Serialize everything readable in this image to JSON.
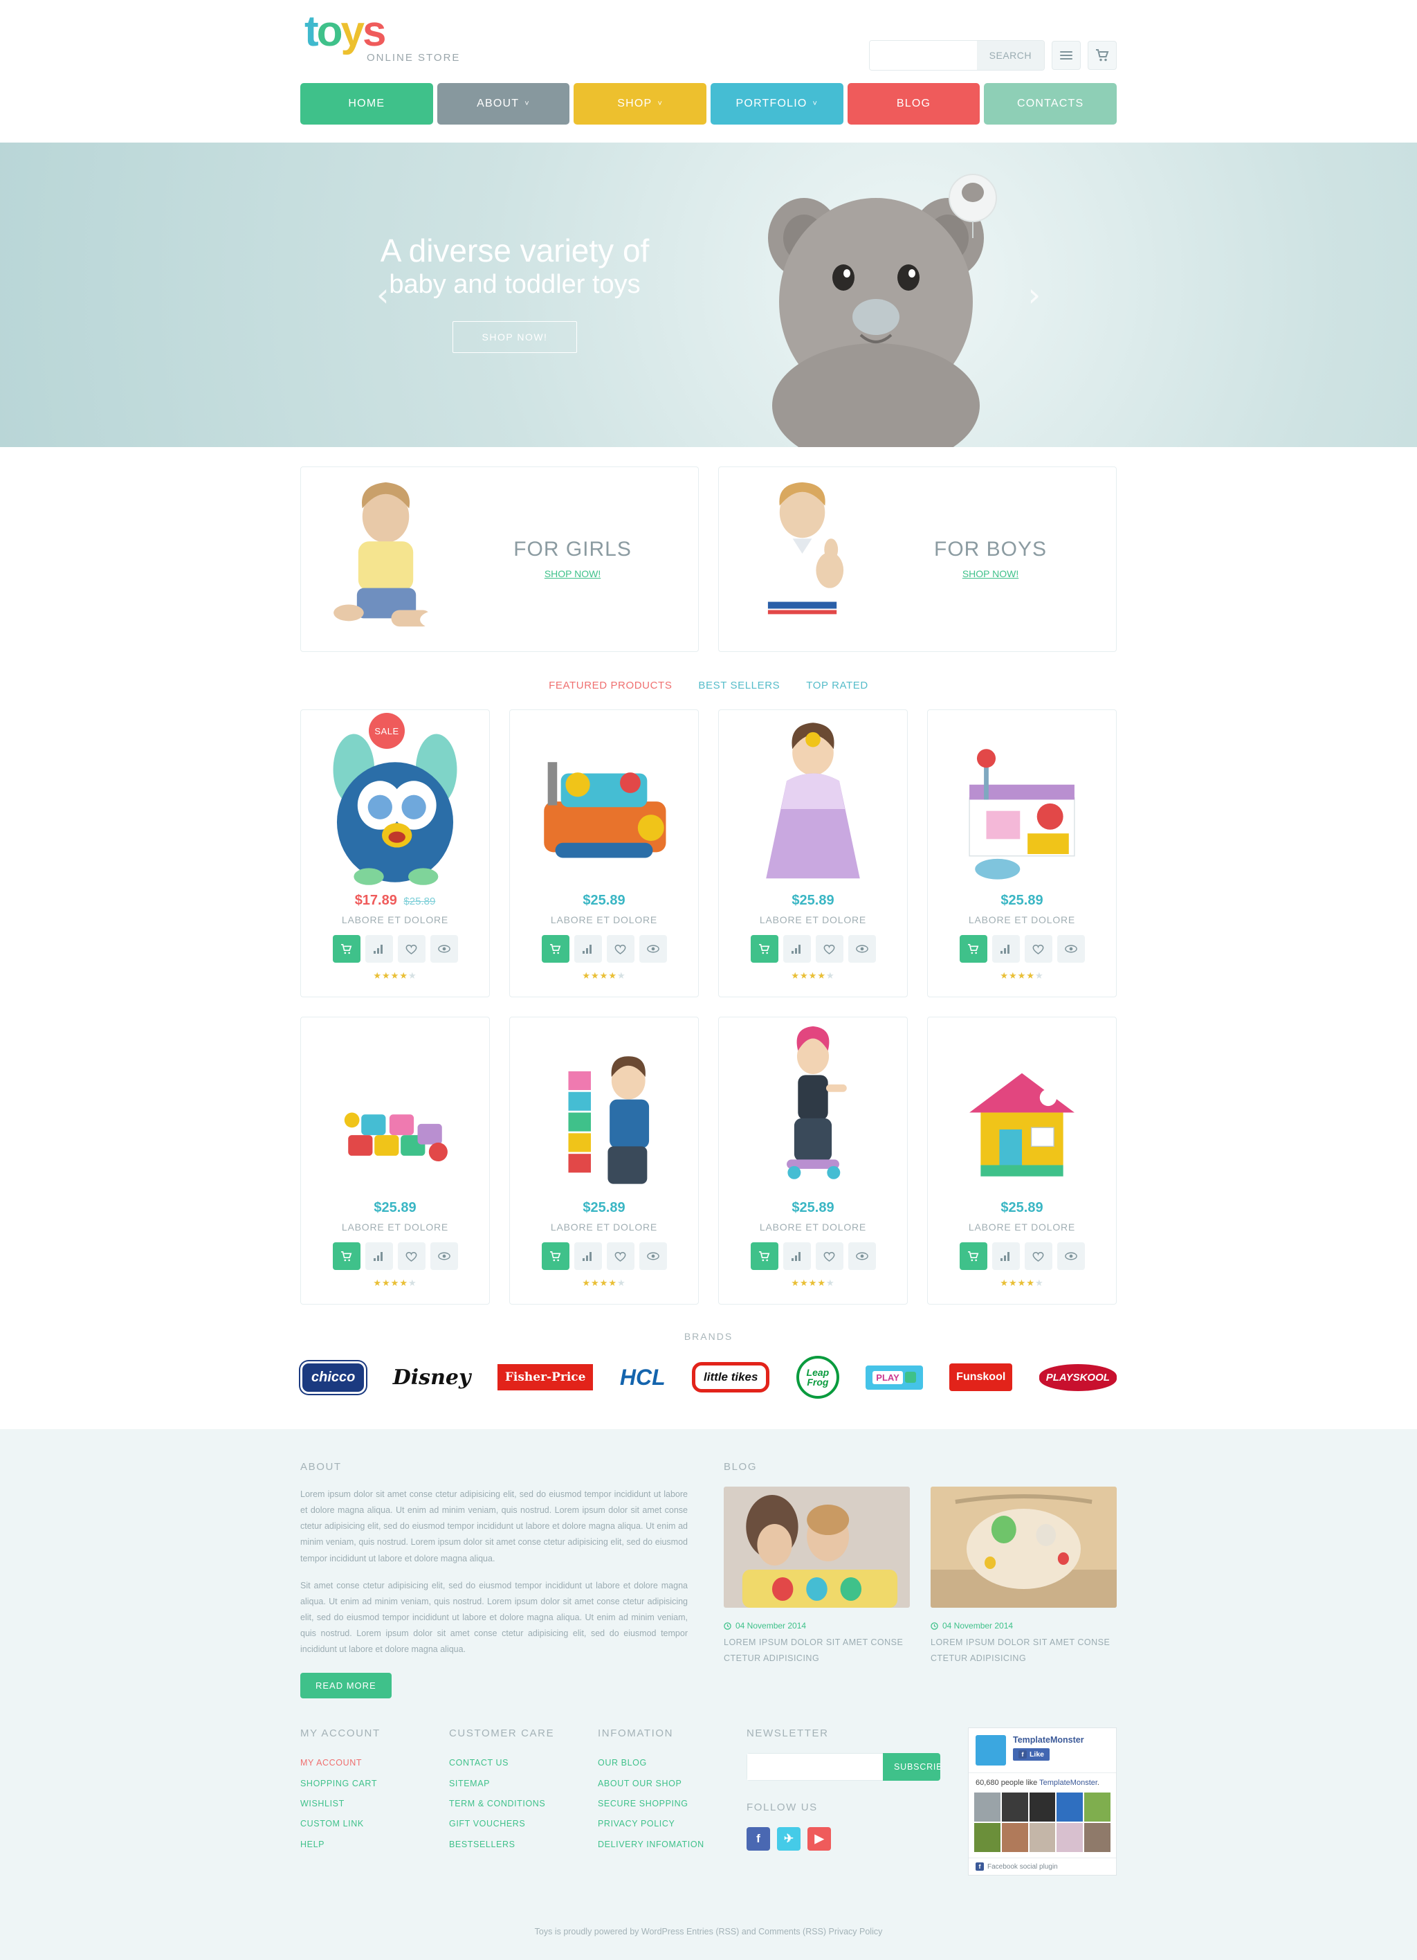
{
  "brand": {
    "logo_letters": [
      "t",
      "o",
      "y",
      "s"
    ],
    "logo_subtitle": "ONLINE STORE"
  },
  "header": {
    "search_placeholder": "",
    "search_value": "",
    "search_button": "SEARCH",
    "menu_icon": "hamburger-icon",
    "cart_icon": "cart-icon"
  },
  "nav": [
    {
      "label": "HOME",
      "color": "#3fc18a",
      "caret": ""
    },
    {
      "label": "ABOUT",
      "color": "#87989e",
      "caret": "˅"
    },
    {
      "label": "SHOP",
      "color": "#edc02e",
      "caret": "˅"
    },
    {
      "label": "PORTFOLIO",
      "color": "#45bdd3",
      "caret": "˅"
    },
    {
      "label": "BLOG",
      "color": "#ef5b5b",
      "caret": ""
    },
    {
      "label": "CONTACTS",
      "color": "#8ecfb6",
      "caret": ""
    }
  ],
  "hero": {
    "line1": "A diverse variety of",
    "line2": "baby and toddler toys",
    "button": "SHOP NOW!",
    "prev_icon": "chevron-left-icon",
    "next_icon": "chevron-right-icon"
  },
  "categories": [
    {
      "title": "FOR GIRLS",
      "link": "SHOP NOW!"
    },
    {
      "title": "FOR BOYS",
      "link": "SHOP NOW!"
    }
  ],
  "tabs": [
    {
      "label": "FEATURED PRODUCTS",
      "active": true
    },
    {
      "label": "BEST SELLERS",
      "active": false
    },
    {
      "label": "TOP RATED",
      "active": false
    }
  ],
  "products_row1": [
    {
      "badge": "SALE",
      "price": "$17.89",
      "old_price": "$25.89",
      "name": "LABORE ET DOLORE",
      "rating": 4
    },
    {
      "badge": "",
      "price": "$25.89",
      "old_price": "",
      "name": "LABORE ET DOLORE",
      "rating": 4
    },
    {
      "badge": "",
      "price": "$25.89",
      "old_price": "",
      "name": "LABORE ET DOLORE",
      "rating": 4
    },
    {
      "badge": "",
      "price": "$25.89",
      "old_price": "",
      "name": "LABORE ET DOLORE",
      "rating": 4
    }
  ],
  "products_row2": [
    {
      "badge": "",
      "price": "$25.89",
      "old_price": "",
      "name": "LABORE ET DOLORE",
      "rating": 4
    },
    {
      "badge": "",
      "price": "$25.89",
      "old_price": "",
      "name": "LABORE ET DOLORE",
      "rating": 4
    },
    {
      "badge": "",
      "price": "$25.89",
      "old_price": "",
      "name": "LABORE ET DOLORE",
      "rating": 4
    },
    {
      "badge": "",
      "price": "$25.89",
      "old_price": "",
      "name": "LABORE ET DOLORE",
      "rating": 4
    }
  ],
  "product_actions": {
    "cart": "cart-icon",
    "compare": "compare-icon",
    "wishlist": "heart-icon",
    "quickview": "eye-icon"
  },
  "brands": {
    "title": "BRANDS",
    "items": [
      "chicco",
      "Disney",
      "Fisher-Price",
      "HCL",
      "little tikes",
      "Leap Frog",
      "PLAY",
      "Funskool",
      "PLAYSKOOL"
    ]
  },
  "footer": {
    "about_title": "ABOUT",
    "about_p1": "Lorem ipsum dolor sit amet conse ctetur adipisicing elit, sed do eiusmod tempor incididunt ut labore et dolore magna aliqua. Ut enim ad minim veniam, quis nostrud. Lorem ipsum dolor sit amet conse ctetur adipisicing elit, sed do eiusmod tempor incididunt ut labore et dolore magna aliqua. Ut enim ad minim veniam, quis nostrud. Lorem ipsum dolor sit amet conse ctetur adipisicing elit, sed do eiusmod tempor incididunt ut labore et dolore magna aliqua.",
    "about_p2": "Sit amet conse ctetur adipisicing elit, sed do eiusmod tempor incididunt ut labore et dolore magna aliqua. Ut enim ad minim veniam, quis nostrud. Lorem ipsum dolor sit amet conse ctetur adipisicing elit, sed do eiusmod tempor incididunt ut labore et dolore magna aliqua. Ut enim ad minim veniam, quis nostrud. Lorem ipsum dolor sit amet conse ctetur adipisicing elit, sed do eiusmod tempor incididunt ut labore et dolore magna aliqua.",
    "read_more": "READ MORE",
    "blog_title": "BLOG",
    "blog_posts": [
      {
        "date": "04 November 2014",
        "title": "LOREM IPSUM DOLOR SIT AMET CONSE CTETUR ADIPISICING"
      },
      {
        "date": "04 November 2014",
        "title": "LOREM IPSUM DOLOR SIT AMET CONSE CTETUR ADIPISICING"
      }
    ],
    "columns": [
      {
        "title": "MY ACCOUNT",
        "links": [
          {
            "label": "MY ACCOUNT",
            "highlight": true
          },
          {
            "label": "SHOPPING CART",
            "highlight": false
          },
          {
            "label": "WISHLIST",
            "highlight": false
          },
          {
            "label": "CUSTOM LINK",
            "highlight": false
          },
          {
            "label": "HELP",
            "highlight": false
          }
        ]
      },
      {
        "title": "CUSTOMER CARE",
        "links": [
          {
            "label": "CONTACT US",
            "highlight": false
          },
          {
            "label": "SITEMAP",
            "highlight": false
          },
          {
            "label": "TERM & CONDITIONS",
            "highlight": false
          },
          {
            "label": "GIFT VOUCHERS",
            "highlight": false
          },
          {
            "label": "BESTSELLERS",
            "highlight": false
          }
        ]
      },
      {
        "title": "INFOMATION",
        "links": [
          {
            "label": "OUR BLOG",
            "highlight": false
          },
          {
            "label": "ABOUT OUR SHOP",
            "highlight": false
          },
          {
            "label": "SECURE SHOPPING",
            "highlight": false
          },
          {
            "label": "PRIVACY POLICY",
            "highlight": false
          },
          {
            "label": "DELIVERY INFOMATION",
            "highlight": false
          }
        ]
      }
    ],
    "newsletter_title": "NEWSLETTER",
    "newsletter_value": "",
    "newsletter_button": "SUBSCRIBE",
    "follow_title": "FOLLOW US",
    "socials": [
      {
        "name": "facebook",
        "glyph": "f",
        "color": "#4a68b2"
      },
      {
        "name": "twitter",
        "glyph": "✈",
        "color": "#45cbe8"
      },
      {
        "name": "youtube",
        "glyph": "▶",
        "color": "#ef5b5b"
      }
    ],
    "facebook_widget": {
      "page_name": "TemplateMonster",
      "like_label": "Like",
      "likes_text_before": "60,680 people like ",
      "likes_link": "TemplateMonster",
      "likes_text_after": ".",
      "plugin_label": "Facebook social plugin"
    },
    "copyright": "Toys is proudly powered by WordPress Entries (RSS) and Comments (RSS) Privacy Policy"
  }
}
